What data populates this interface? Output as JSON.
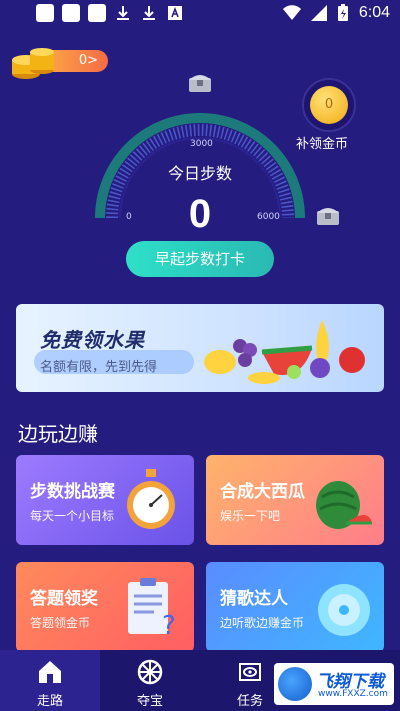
{
  "status_bar": {
    "time": "6:04"
  },
  "coins": {
    "balance": "0>"
  },
  "gauge": {
    "title": "今日步数",
    "value": "0",
    "tick_min": "0",
    "tick_mid": "3000",
    "tick_max": "6000"
  },
  "bonus": {
    "coin_value": "0",
    "label": "补领金币"
  },
  "checkin": {
    "label": "早起步数打卡"
  },
  "banner": {
    "title": "免费领水果",
    "subtitle": "名额有限，先到先得"
  },
  "section": {
    "title": "边玩边赚"
  },
  "cards": [
    {
      "title": "步数挑战赛",
      "subtitle": "每天一个小目标"
    },
    {
      "title": "合成大西瓜",
      "subtitle": "娱乐一下吧"
    },
    {
      "title": "答题领奖",
      "subtitle": "答题领金币"
    },
    {
      "title": "猜歌达人",
      "subtitle": "边听歌边赚金币"
    }
  ],
  "tabs": [
    {
      "label": "走路"
    },
    {
      "label": "夺宝"
    },
    {
      "label": "任务"
    },
    {
      "label": ""
    }
  ],
  "watermark": {
    "text": "飞翔下载",
    "url": "www.FXXZ.com"
  }
}
